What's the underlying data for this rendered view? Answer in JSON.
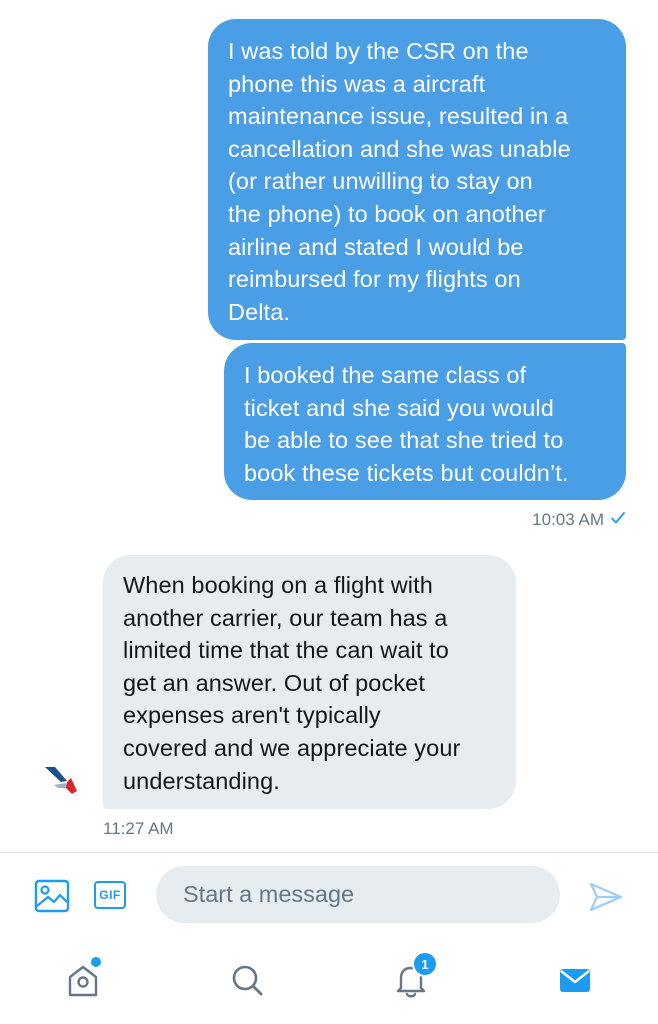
{
  "conversation": {
    "outgoing_messages": [
      {
        "text": "I was told by the CSR on the\nphone this was a aircraft\nmaintenance issue, resulted in a\ncancellation and she was unable\n(or rather unwilling to stay on\nthe phone) to book on another\nairline and stated I would be\nreimbursed for my flights on\nDelta."
      },
      {
        "text": "I booked the same class of\nticket and she said you would\nbe able to see that she tried to\nbook these tickets but couldn’t."
      }
    ],
    "outgoing_timestamp": "10:03 AM",
    "incoming_message": {
      "text": "When booking on a flight with\nanother carrier, our team has a\nlimited time that the can wait to\nget an answer. Out of pocket\nexpenses aren't typically\ncovered and we appreciate your\nunderstanding."
    },
    "incoming_timestamp": "11:27 AM"
  },
  "composer": {
    "placeholder": "Start a message",
    "value": "",
    "gif_label": "GIF"
  },
  "tabbar": {
    "notifications_badge": "1"
  },
  "colors": {
    "outgoing_bubble": "#4a9ee6",
    "incoming_bubble": "#e6ecf0",
    "accent": "#1d9bf0",
    "timestamp": "#657786"
  },
  "icons": {
    "read_receipt": "check-icon",
    "avatar": "american-airlines-logo",
    "photo": "image-icon",
    "send": "send-icon",
    "home": "home-icon",
    "search": "search-icon",
    "notifications": "bell-icon",
    "messages": "envelope-icon"
  }
}
